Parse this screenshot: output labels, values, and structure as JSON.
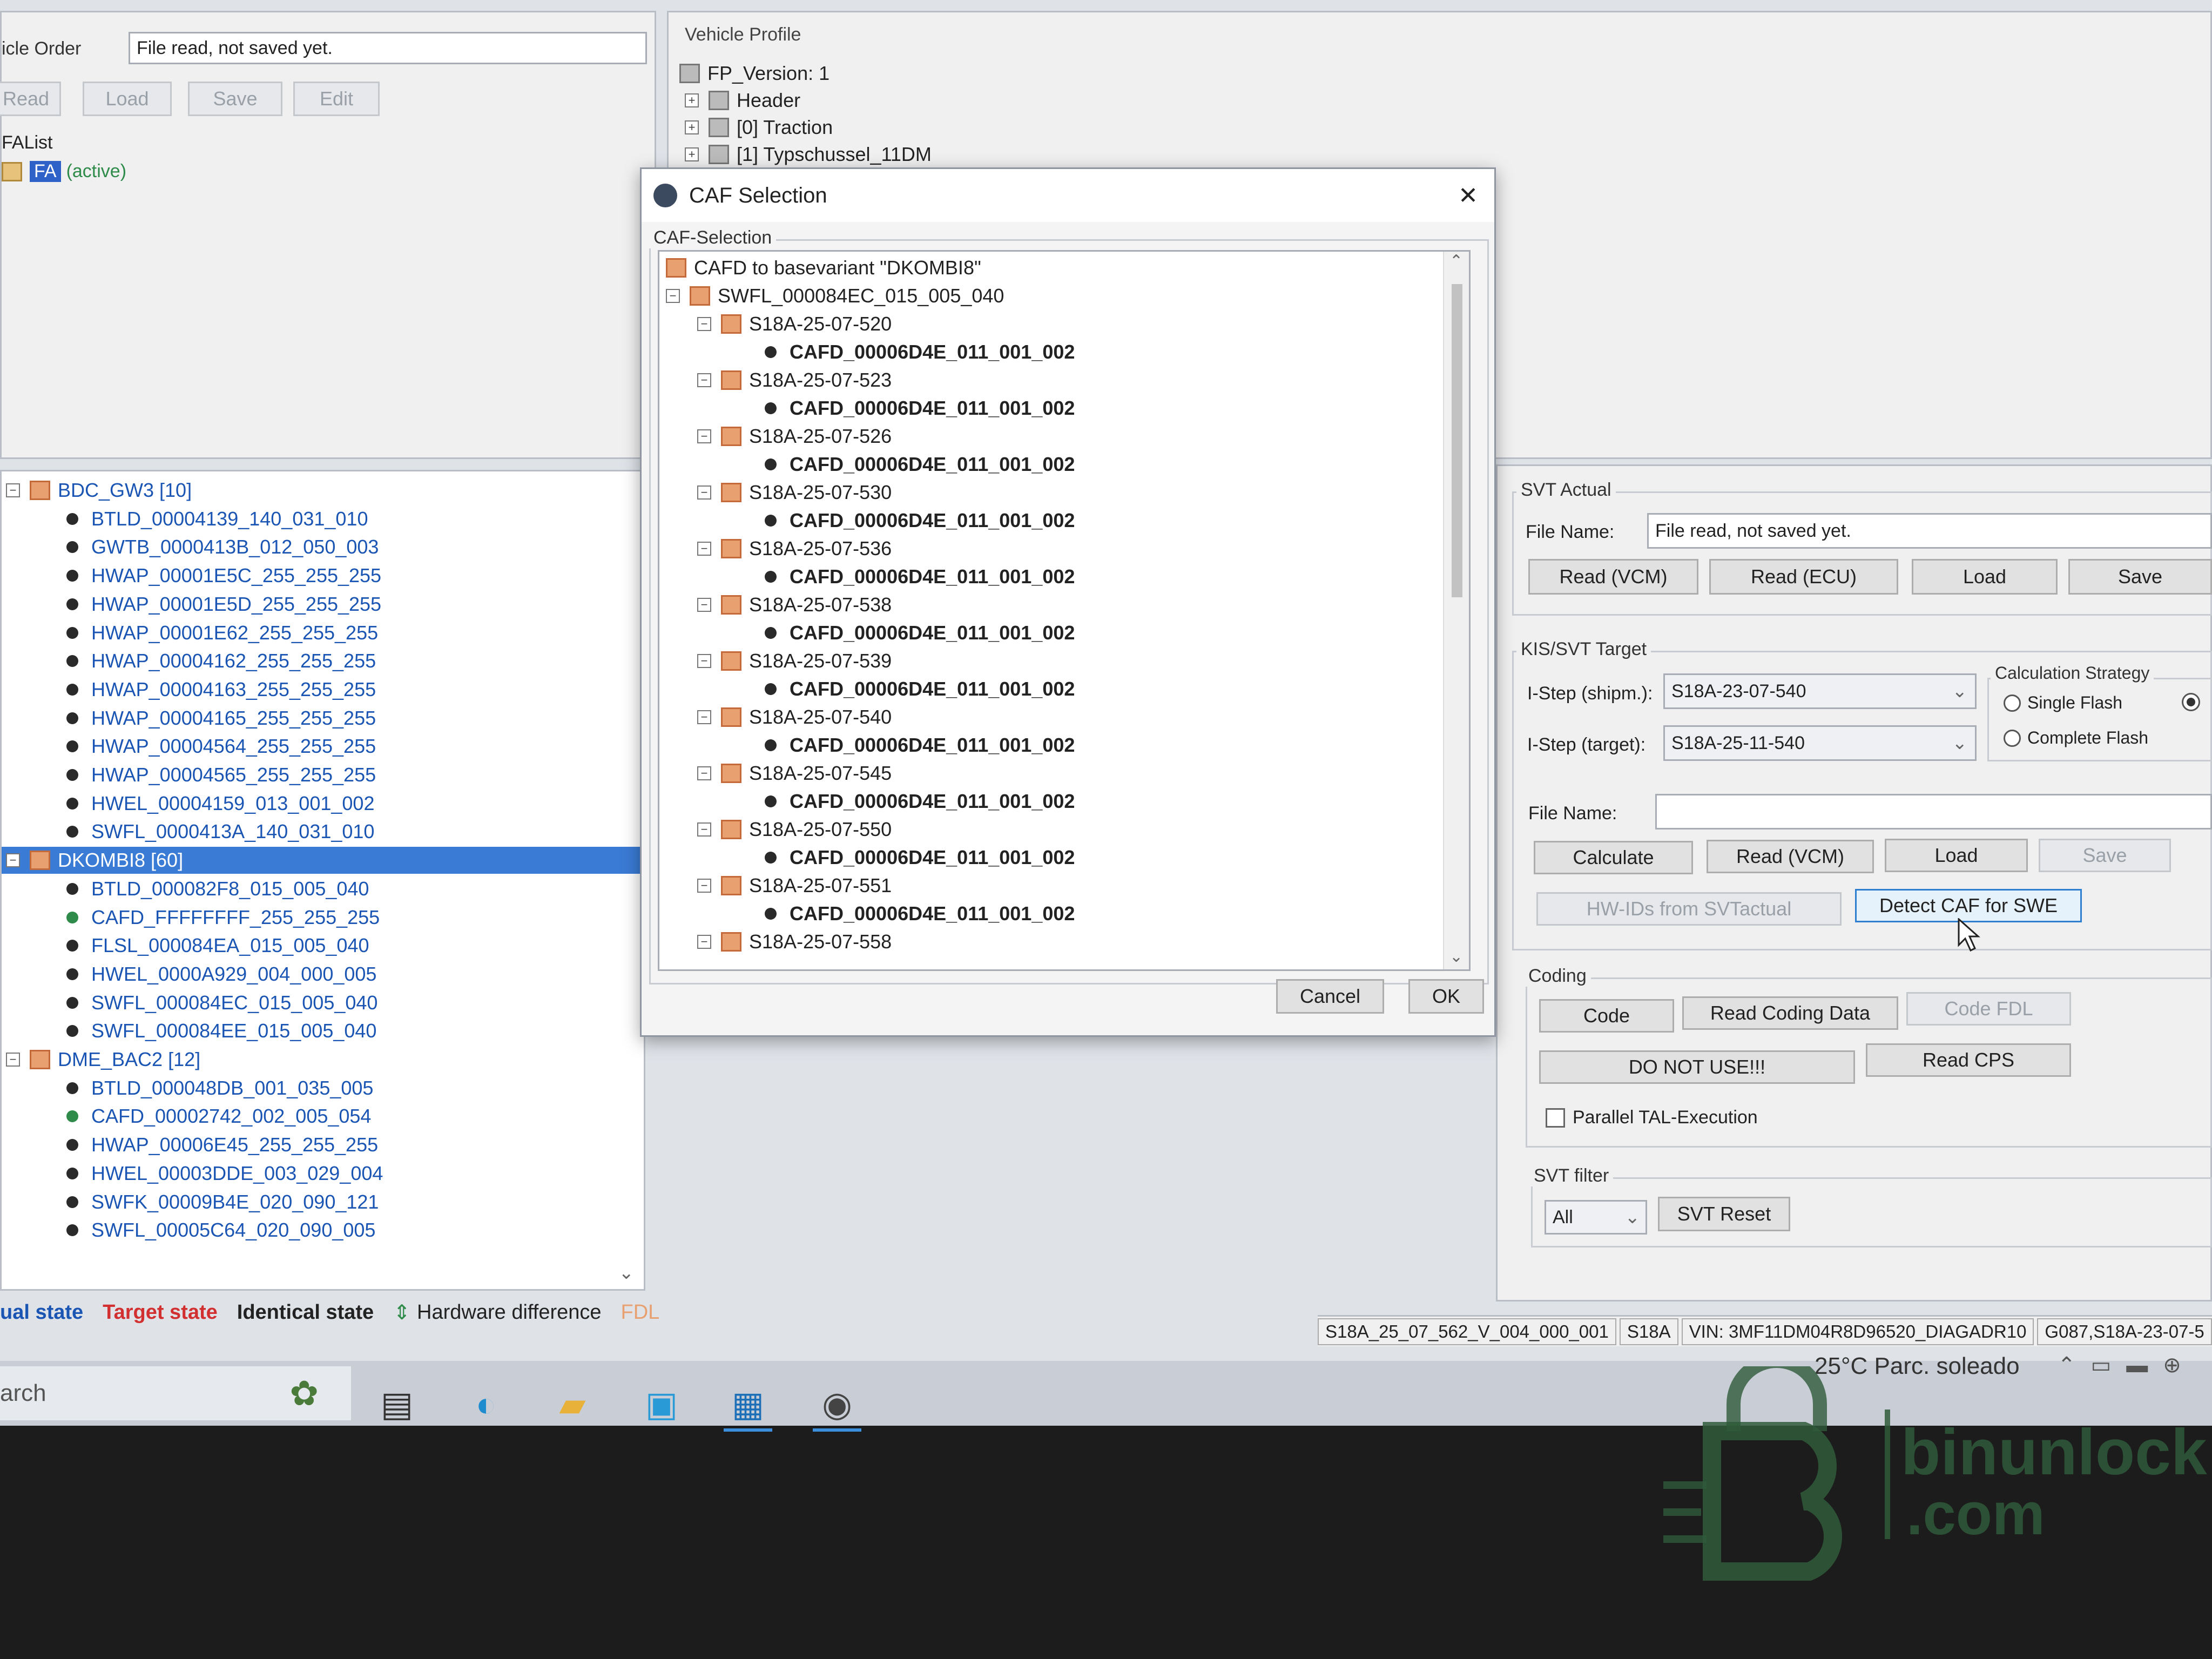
{
  "left_top": {
    "order_label": "icle Order",
    "order_field": "File read, not saved yet.",
    "buttons": [
      "Read",
      "Load",
      "Save",
      "Edit"
    ],
    "falist_label": "FAList",
    "fa_item": "FA",
    "fa_active": "(active)"
  },
  "vehicle_profile": {
    "title": "Vehicle Profile",
    "items": [
      "FP_Version: 1",
      "Header",
      "[0] Traction",
      "[1] Typschussel_11DM"
    ]
  },
  "ecu_tree": [
    {
      "label": "BDC_GW3 [10]",
      "type": "group"
    },
    {
      "label": "BTLD_00004139_140_031_010",
      "type": "leaf"
    },
    {
      "label": "GWTB_0000413B_012_050_003",
      "type": "leaf"
    },
    {
      "label": "HWAP_00001E5C_255_255_255",
      "type": "leaf"
    },
    {
      "label": "HWAP_00001E5D_255_255_255",
      "type": "leaf"
    },
    {
      "label": "HWAP_00001E62_255_255_255",
      "type": "leaf"
    },
    {
      "label": "HWAP_00004162_255_255_255",
      "type": "leaf"
    },
    {
      "label": "HWAP_00004163_255_255_255",
      "type": "leaf"
    },
    {
      "label": "HWAP_00004165_255_255_255",
      "type": "leaf"
    },
    {
      "label": "HWAP_00004564_255_255_255",
      "type": "leaf"
    },
    {
      "label": "HWAP_00004565_255_255_255",
      "type": "leaf"
    },
    {
      "label": "HWEL_00004159_013_001_002",
      "type": "leaf"
    },
    {
      "label": "SWFL_0000413A_140_031_010",
      "type": "leaf"
    },
    {
      "label": "DKOMBI8 [60]",
      "type": "group",
      "selected": true
    },
    {
      "label": "BTLD_000082F8_015_005_040",
      "type": "leaf"
    },
    {
      "label": "CAFD_FFFFFFFF_255_255_255",
      "type": "leaf",
      "green": true
    },
    {
      "label": "FLSL_000084EA_015_005_040",
      "type": "leaf"
    },
    {
      "label": "HWEL_0000A929_004_000_005",
      "type": "leaf"
    },
    {
      "label": "SWFL_000084EC_015_005_040",
      "type": "leaf"
    },
    {
      "label": "SWFL_000084EE_015_005_040",
      "type": "leaf"
    },
    {
      "label": "DME_BAC2 [12]",
      "type": "group"
    },
    {
      "label": "BTLD_000048DB_001_035_005",
      "type": "leaf"
    },
    {
      "label": "CAFD_00002742_002_005_054",
      "type": "leaf",
      "green": true
    },
    {
      "label": "HWAP_00006E45_255_255_255",
      "type": "leaf"
    },
    {
      "label": "HWEL_00003DDE_003_029_004",
      "type": "leaf"
    },
    {
      "label": "SWFK_00009B4E_020_090_121",
      "type": "leaf"
    },
    {
      "label": "SWFL_00005C64_020_090_005",
      "type": "leaf"
    }
  ],
  "legend": {
    "actual": "ual state",
    "target": "Target state",
    "identical": "Identical state",
    "hw_diff": "Hardware difference",
    "fdl": "FDL"
  },
  "dialog": {
    "title": "CAF Selection",
    "close": "✕",
    "group_label": "CAF-Selection",
    "root": "CAFD to basevariant \"DKOMBI8\"",
    "swfl": "SWFL_000084EC_015_005_040",
    "steps": [
      {
        "istep": "S18A-25-07-520",
        "cafd": "CAFD_00006D4E_011_001_002"
      },
      {
        "istep": "S18A-25-07-523",
        "cafd": "CAFD_00006D4E_011_001_002"
      },
      {
        "istep": "S18A-25-07-526",
        "cafd": "CAFD_00006D4E_011_001_002"
      },
      {
        "istep": "S18A-25-07-530",
        "cafd": "CAFD_00006D4E_011_001_002"
      },
      {
        "istep": "S18A-25-07-536",
        "cafd": "CAFD_00006D4E_011_001_002"
      },
      {
        "istep": "S18A-25-07-538",
        "cafd": "CAFD_00006D4E_011_001_002"
      },
      {
        "istep": "S18A-25-07-539",
        "cafd": "CAFD_00006D4E_011_001_002"
      },
      {
        "istep": "S18A-25-07-540",
        "cafd": "CAFD_00006D4E_011_001_002"
      },
      {
        "istep": "S18A-25-07-545",
        "cafd": "CAFD_00006D4E_011_001_002"
      },
      {
        "istep": "S18A-25-07-550",
        "cafd": "CAFD_00006D4E_011_001_002"
      },
      {
        "istep": "S18A-25-07-551",
        "cafd": "CAFD_00006D4E_011_001_002"
      },
      {
        "istep": "S18A-25-07-558",
        "cafd": ""
      }
    ],
    "cancel": "Cancel",
    "ok": "OK"
  },
  "svt_actual": {
    "title": "SVT Actual",
    "file_label": "File Name:",
    "file_value": "File read, not saved yet.",
    "buttons": [
      "Read (VCM)",
      "Read (ECU)",
      "Load",
      "Save"
    ]
  },
  "kis_target": {
    "title": "KIS/SVT Target",
    "istep_shipm_label": "I-Step (shipm.):",
    "istep_shipm_value": "S18A-23-07-540",
    "istep_target_label": "I-Step (target):",
    "istep_target_value": "S18A-25-11-540",
    "calc_title": "Calculation Strategy",
    "single_flash": "Single Flash",
    "complete_flash": "Complete Flash",
    "file_label": "File Name:",
    "file_value": "",
    "buttons": [
      "Calculate",
      "Read (VCM)",
      "Load",
      "Save"
    ],
    "hwids": "HW-IDs from SVTactual",
    "detect_caf": "Detect CAF for SWE"
  },
  "coding": {
    "title": "Coding",
    "code": "Code",
    "read_coding": "Read Coding Data",
    "code_fdl": "Code FDL",
    "do_not_use": "DO NOT USE!!!",
    "read_cps": "Read CPS",
    "parallel": "Parallel TAL-Execution"
  },
  "svt_filter": {
    "title": "SVT filter",
    "selected": "All",
    "reset": "SVT Reset"
  },
  "status_bar": {
    "istep": "S18A_25_07_562_V_004_000_001",
    "series": "S18A",
    "vin": "VIN: 3MF11DM04R8D96520_DIAGADR10",
    "extra": "G087,S18A-23-07-5"
  },
  "taskbar": {
    "search": "arch",
    "weather": "25°C  Parc. soleado"
  },
  "watermark": {
    "brand": "binunlock",
    "domain": ".com"
  },
  "colors": {
    "selection": "#3a7bd5",
    "tree_blue": "#1a55b4",
    "target_red": "#d23030",
    "folder": "#e8a071"
  }
}
